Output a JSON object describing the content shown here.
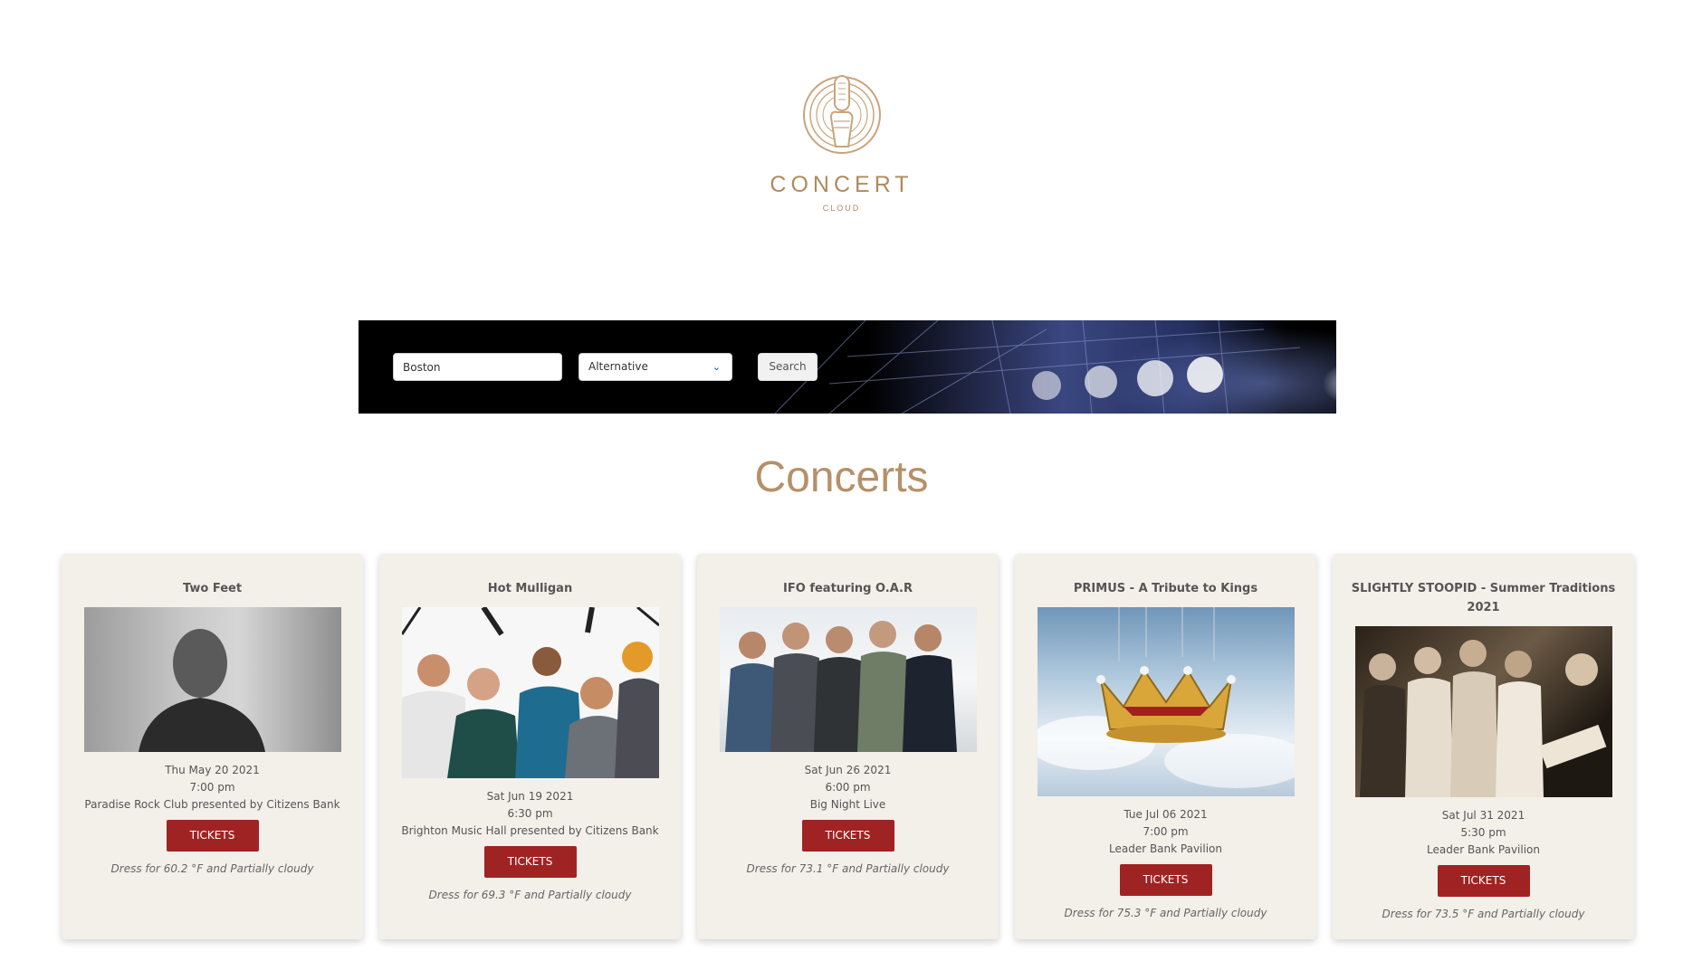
{
  "brand": {
    "name": "CONCERT",
    "sub": "CLOUD"
  },
  "search": {
    "city_value": "Boston",
    "genre_value": "Alternative",
    "button_label": "Search"
  },
  "heading": "Concerts",
  "cards": [
    {
      "title": "Two Feet",
      "date": "Thu May 20 2021",
      "time": "7:00 pm",
      "venue": "Paradise Rock Club presented by Citizens Bank",
      "tickets_label": "TICKETS",
      "weather": "Dress for 60.2 °F and Partially cloudy"
    },
    {
      "title": "Hot Mulligan",
      "date": "Sat Jun 19 2021",
      "time": "6:30 pm",
      "venue": "Brighton Music Hall presented by Citizens Bank",
      "tickets_label": "TICKETS",
      "weather": "Dress for 69.3 °F and Partially cloudy"
    },
    {
      "title": "IFO featuring O.A.R",
      "date": "Sat Jun 26 2021",
      "time": "6:00 pm",
      "venue": "Big Night Live",
      "tickets_label": "TICKETS",
      "weather": "Dress for 73.1 °F and Partially cloudy"
    },
    {
      "title": "PRIMUS - A Tribute to Kings",
      "date": "Tue Jul 06 2021",
      "time": "7:00 pm",
      "venue": "Leader Bank Pavilion",
      "tickets_label": "TICKETS",
      "weather": "Dress for 75.3 °F and Partially cloudy"
    },
    {
      "title": "SLIGHTLY STOOPID - Summer Traditions 2021",
      "date": "Sat Jul 31 2021",
      "time": "5:30 pm",
      "venue": "Leader Bank Pavilion",
      "tickets_label": "TICKETS",
      "weather": "Dress for 73.5 °F and Partially cloudy"
    }
  ],
  "colors": {
    "accent": "#b08a5e",
    "button": "#a02323",
    "card_bg": "#f3efe9"
  }
}
